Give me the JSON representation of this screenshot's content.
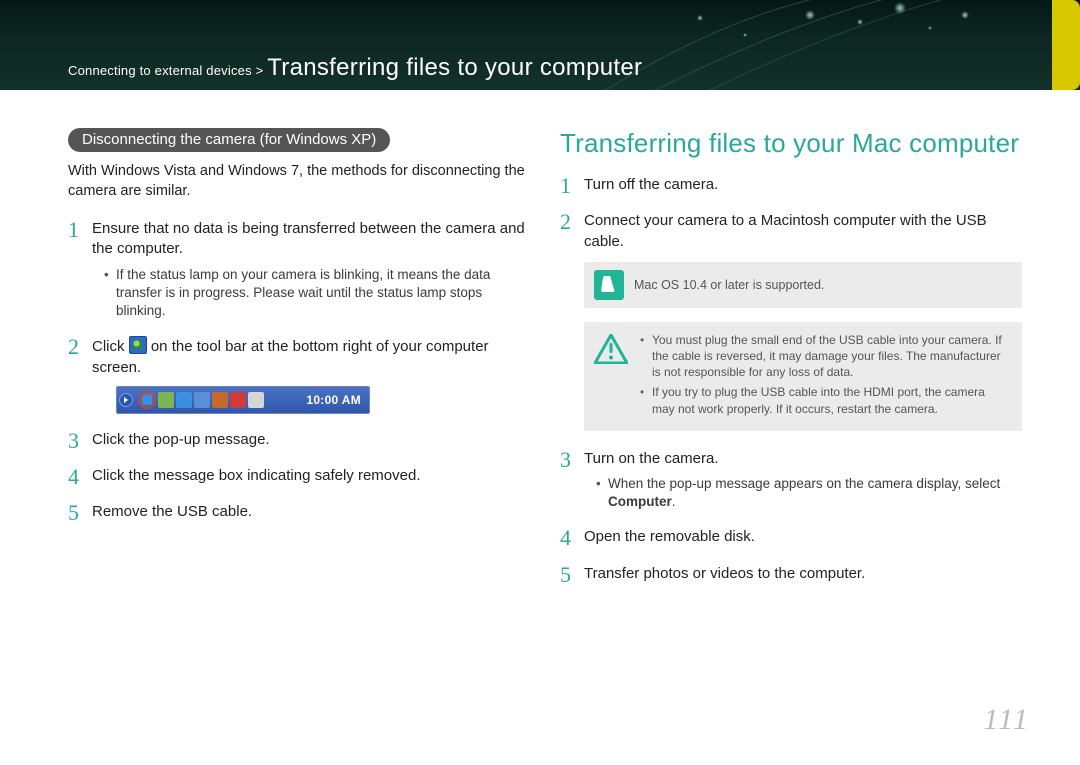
{
  "breadcrumb": {
    "section": "Connecting to external devices",
    "sep": ">",
    "title": "Transferring files to your computer"
  },
  "left": {
    "pill": "Disconnecting the camera (for Windows XP)",
    "intro": "With Windows Vista and Windows 7, the methods for disconnecting the camera are similar.",
    "steps": [
      {
        "text": "Ensure that no data is being transferred between the camera and the computer.",
        "sub": [
          "If the status lamp on your camera is blinking, it means the data transfer is in progress. Please wait until the status lamp stops blinking."
        ]
      },
      {
        "pre": "Click ",
        "post": " on the tool bar at the bottom right of your computer screen."
      },
      {
        "text": "Click the pop-up message."
      },
      {
        "text": "Click the message box indicating safely removed."
      },
      {
        "text": "Remove the USB cable."
      }
    ],
    "taskbar_time": "10:00 AM"
  },
  "right": {
    "heading": "Transferring files to your Mac computer",
    "steps": [
      {
        "text": "Turn off the camera."
      },
      {
        "text": "Connect your camera to a Macintosh computer with the USB cable."
      },
      {
        "text": "Turn on the camera.",
        "sub_pre": "When the pop-up message appears on the camera display, select ",
        "sub_bold": "Computer",
        "sub_post": "."
      },
      {
        "text": "Open the removable disk."
      },
      {
        "text": "Transfer photos or videos to the computer."
      }
    ],
    "note": "Mac OS 10.4 or later is supported.",
    "warnings": [
      "You must plug the small end of the USB cable into your camera. If the cable is reversed, it may damage your files. The manufacturer is not responsible for any loss of data.",
      "If you try to plug the USB cable into the HDMI port, the camera may not work properly. If it occurs, restart the camera."
    ]
  },
  "page_number": "111"
}
